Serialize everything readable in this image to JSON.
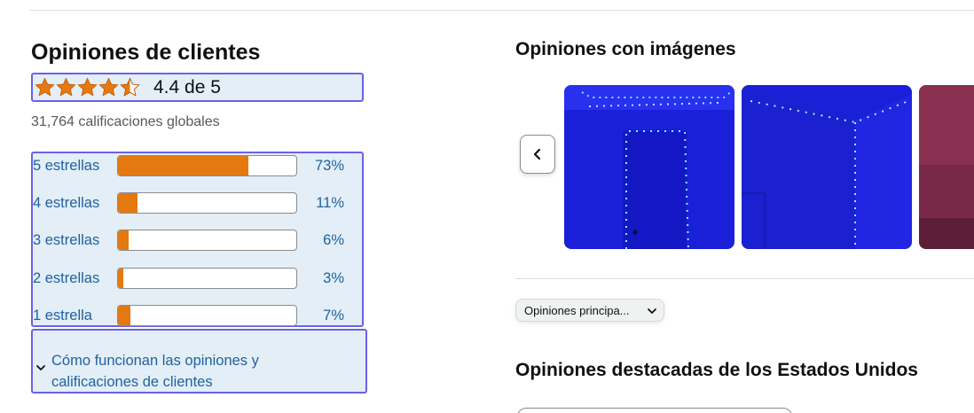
{
  "reviews": {
    "title": "Opiniones de clientes",
    "rating_text": "4.4 de 5",
    "rating_value": 4.4,
    "rating_max": 5,
    "total_ratings": "31,764 calificaciones globales",
    "histogram": [
      {
        "label": "5 estrellas",
        "percent_text": "73%",
        "percent": 73
      },
      {
        "label": "4 estrellas",
        "percent_text": "11%",
        "percent": 11
      },
      {
        "label": "3 estrellas",
        "percent_text": "6%",
        "percent": 6
      },
      {
        "label": "2 estrellas",
        "percent_text": "3%",
        "percent": 3
      },
      {
        "label": "1 estrella",
        "percent_text": "7%",
        "percent": 7
      }
    ],
    "how_it_works": "Cómo funcionan las opiniones y calificaciones de clientes"
  },
  "images_section": {
    "title": "Opiniones con imágenes"
  },
  "sort": {
    "selected": "Opiniones principa..."
  },
  "featured": {
    "title": "Opiniones destacadas de los Estados Unidos"
  },
  "colors": {
    "star": "#e47911",
    "bar_fill": "#e47911",
    "link": "#2162a1",
    "highlight_border": "#6a62e8",
    "highlight_bg": "#e3eef6"
  }
}
